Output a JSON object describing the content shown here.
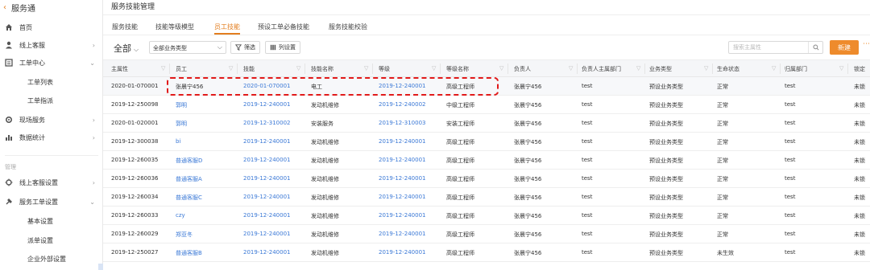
{
  "app": {
    "back_glyph": "‹",
    "title": "服务通"
  },
  "page": {
    "title": "服务技能管理"
  },
  "sidebar": {
    "items": [
      {
        "label": "首页",
        "icon": "home-icon",
        "chevron": ""
      },
      {
        "label": "线上客服",
        "icon": "user-icon",
        "chevron": "›"
      },
      {
        "label": "工单中心",
        "icon": "ticket-icon",
        "chevron": "⌄"
      },
      {
        "label": "现场服务",
        "icon": "gear-icon",
        "chevron": "›"
      },
      {
        "label": "数据统计",
        "icon": "chart-icon",
        "chevron": "›"
      },
      {
        "label": "线上客服设置",
        "icon": "settings-icon",
        "chevron": "›"
      },
      {
        "label": "服务工单设置",
        "icon": "tools-icon",
        "chevron": "⌄"
      }
    ],
    "sub_items": [
      "工单列表",
      "工单指派"
    ],
    "sub_items_2": [
      "基本设置",
      "派单设置",
      "企业外部设置"
    ],
    "section_label": "管理"
  },
  "tabs": [
    "服务技能",
    "技能等级模型",
    "员工技能",
    "预设工单必备技能",
    "服务技能校验"
  ],
  "active_tab": 2,
  "toolbar": {
    "filter_label": "全部",
    "filter_caret": "⌵",
    "biz_type": "全部业务类型",
    "biz_caret": "⌵",
    "filter_btn": "筛选",
    "filter_btn_icon": "funnel-icon",
    "columns_btn": "列设置",
    "columns_btn_icon": "columns-icon",
    "search_placeholder": "搜索主属性",
    "new_btn": "新建",
    "more_btn": "⋯"
  },
  "table": {
    "columns": [
      "主属性",
      "员工",
      "技能",
      "技能名称",
      "等级",
      "等级名称",
      "负责人",
      "负责人主属部门",
      "业务类型",
      "生命状态",
      "归属部门",
      "锁定"
    ],
    "rows": [
      [
        "2020-01-070001",
        "张晨宁456",
        "2020-01-070001",
        "电工",
        "2019-12-240001",
        "高级工程师",
        "张晨宁456",
        "test",
        "预设业务类型",
        "正常",
        "test",
        "未锁"
      ],
      [
        "2019-12-250098",
        "郭明",
        "2019-12-240001",
        "发动机维修",
        "2019-12-240002",
        "中级工程师",
        "张晨宁456",
        "test",
        "预设业务类型",
        "正常",
        "test",
        "未锁"
      ],
      [
        "2020-01-020001",
        "郭明",
        "2019-12-310002",
        "安装服务",
        "2019-12-310003",
        "安装工程师",
        "张晨宁456",
        "test",
        "预设业务类型",
        "正常",
        "test",
        "未锁"
      ],
      [
        "2019-12-300038",
        "bi",
        "2019-12-240001",
        "发动机维修",
        "2019-12-240001",
        "高级工程师",
        "张晨宁456",
        "test",
        "预设业务类型",
        "正常",
        "test",
        "未锁"
      ],
      [
        "2019-12-260035",
        "普通客服D",
        "2019-12-240001",
        "发动机维修",
        "2019-12-240001",
        "高级工程师",
        "张晨宁456",
        "test",
        "预设业务类型",
        "正常",
        "test",
        "未锁"
      ],
      [
        "2019-12-260036",
        "普通客服A",
        "2019-12-240001",
        "发动机维修",
        "2019-12-240001",
        "高级工程师",
        "张晨宁456",
        "test",
        "预设业务类型",
        "正常",
        "test",
        "未锁"
      ],
      [
        "2019-12-260034",
        "普通客服C",
        "2019-12-240001",
        "发动机维修",
        "2019-12-240001",
        "高级工程师",
        "张晨宁456",
        "test",
        "预设业务类型",
        "正常",
        "test",
        "未锁"
      ],
      [
        "2019-12-260033",
        "czy",
        "2019-12-240001",
        "发动机维修",
        "2019-12-240001",
        "高级工程师",
        "张晨宁456",
        "test",
        "预设业务类型",
        "正常",
        "test",
        "未锁"
      ],
      [
        "2019-12-260029",
        "郑亚冬",
        "2019-12-240001",
        "发动机维修",
        "2019-12-240001",
        "高级工程师",
        "张晨宁456",
        "test",
        "预设业务类型",
        "正常",
        "test",
        "未锁"
      ],
      [
        "2019-12-250027",
        "普通客服B",
        "2019-12-240001",
        "发动机维修",
        "2019-12-240001",
        "高级工程师",
        "张晨宁456",
        "test",
        "预设业务类型",
        "未生效",
        "test",
        "未锁"
      ]
    ]
  },
  "colors": {
    "accent": "#ee8b2c",
    "link": "#3a78d6",
    "highlight_border": "#e11a1a"
  }
}
